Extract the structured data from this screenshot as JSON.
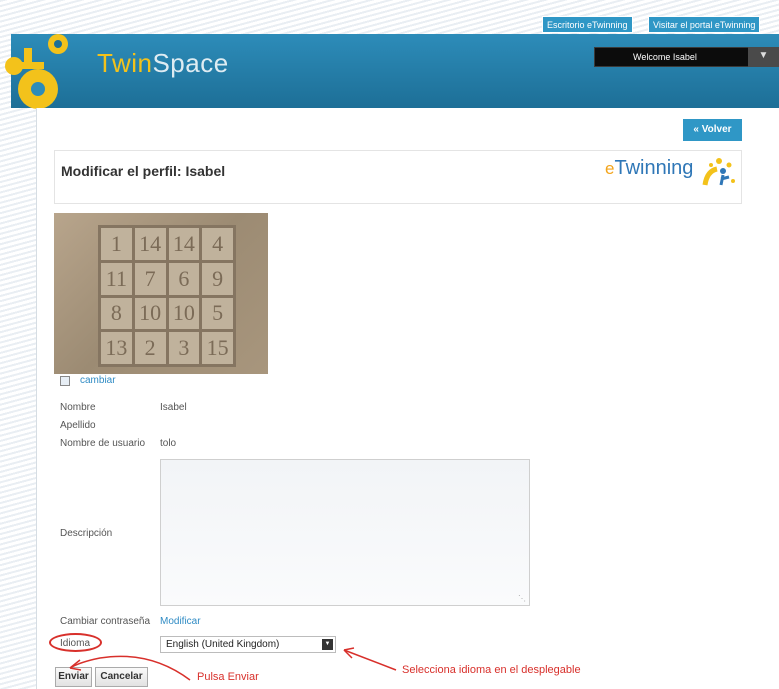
{
  "top_links": {
    "escritorio": "Escritorio eTwinning",
    "visitar": "Visitar el portal eTwinning"
  },
  "brand": {
    "twin": "Twin",
    "space": "Space"
  },
  "user_menu": {
    "welcome": "Welcome Isabel"
  },
  "page": {
    "back_button": "« Volver",
    "title": "Modificar el perfil: Isabel",
    "etwinning_logo": {
      "e": "e",
      "rest": "Twinning"
    }
  },
  "photo": {
    "numbers": [
      "1",
      "14",
      "14",
      "4",
      "11",
      "7",
      "6",
      "9",
      "8",
      "10",
      "10",
      "5",
      "13",
      "2",
      "3",
      "15"
    ],
    "change_link": "cambiar"
  },
  "profile": {
    "nombre_label": "Nombre",
    "nombre_value": "Isabel",
    "apellido_label": "Apellido",
    "usuario_label": "Nombre de usuario",
    "usuario_value": "tolo",
    "descripcion_label": "Descripción",
    "descripcion_value": "",
    "password_label": "Cambiar contraseña",
    "password_link": "Modificar",
    "idioma_label": "Idioma",
    "idioma_value": "English (United Kingdom)"
  },
  "buttons": {
    "enviar": "Enviar",
    "cancelar": "Cancelar"
  },
  "annotations": {
    "enviar": "Pulsa Enviar",
    "idioma": "Selecciona idioma en el desplegable",
    "color": "#d8302b"
  },
  "colors": {
    "accent": "#2f97c6",
    "header": "#1d6f97",
    "brand": "#f3c21b"
  }
}
